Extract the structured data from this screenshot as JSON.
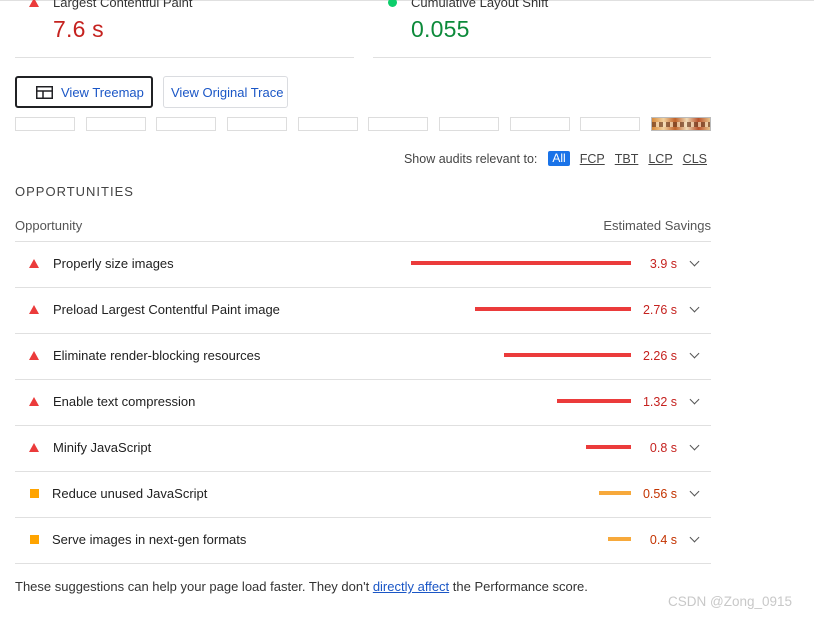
{
  "metrics": {
    "lcp": {
      "label": "Largest Contentful Paint",
      "value": "7.6 s",
      "status_color": "#eb3b3b"
    },
    "cls": {
      "label": "Cumulative Layout Shift",
      "value": "0.055",
      "status_color": "#0cce6b"
    }
  },
  "buttons": {
    "treemap": "View Treemap",
    "trace": "View Original Trace"
  },
  "filter": {
    "label": "Show audits relevant to:",
    "chips": [
      "All",
      "FCP",
      "TBT",
      "LCP",
      "CLS"
    ],
    "active": "All"
  },
  "opportunities": {
    "section_title": "OPPORTUNITIES",
    "col_left": "Opportunity",
    "col_right": "Estimated Savings",
    "items": [
      {
        "title": "Properly size images",
        "savings": "3.9 s",
        "savings_seconds": 3.9,
        "severity": "fail"
      },
      {
        "title": "Preload Largest Contentful Paint image",
        "savings": "2.76 s",
        "savings_seconds": 2.76,
        "severity": "fail"
      },
      {
        "title": "Eliminate render-blocking resources",
        "savings": "2.26 s",
        "savings_seconds": 2.26,
        "severity": "fail"
      },
      {
        "title": "Enable text compression",
        "savings": "1.32 s",
        "savings_seconds": 1.32,
        "severity": "fail"
      },
      {
        "title": "Minify JavaScript",
        "savings": "0.8 s",
        "savings_seconds": 0.8,
        "severity": "fail"
      },
      {
        "title": "Reduce unused JavaScript",
        "savings": "0.56 s",
        "savings_seconds": 0.56,
        "severity": "average"
      },
      {
        "title": "Serve images in next-gen formats",
        "savings": "0.4 s",
        "savings_seconds": 0.4,
        "severity": "average"
      }
    ]
  },
  "footer": {
    "before": "These suggestions can help your page load faster. They don't ",
    "link": "directly affect",
    "after": " the Performance score."
  },
  "watermark": "CSDN @Zong_0915",
  "colors": {
    "fail": "#eb3b3b",
    "average": "#ffa400",
    "pass": "#0cce6b",
    "link": "#1a56c6"
  }
}
